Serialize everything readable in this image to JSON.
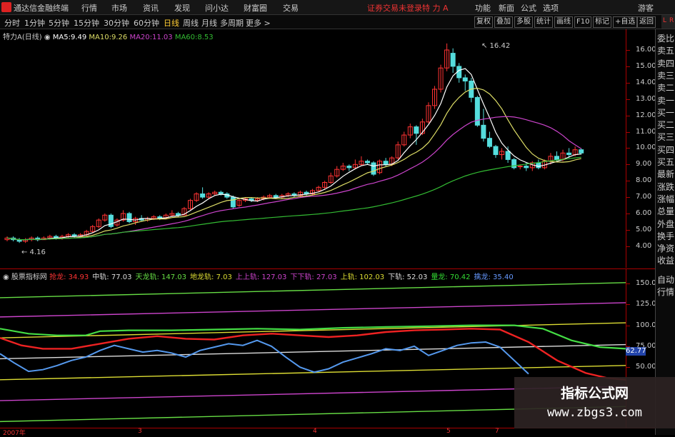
{
  "app": {
    "title": "通达信金融终端"
  },
  "menu": {
    "items": [
      "行情",
      "市场",
      "资讯",
      "发现",
      "问小达",
      "财富圈",
      "交易"
    ]
  },
  "status": {
    "login": "证券交易未登录",
    "stock": "特 力 A"
  },
  "right_menu": {
    "items": [
      "功能",
      "新面",
      "公式",
      "选项"
    ],
    "guest": "游客"
  },
  "periods": [
    "分时",
    "1分钟",
    "5分钟",
    "15分钟",
    "30分钟",
    "60分钟",
    "日线",
    "周线",
    "月线",
    "多周期",
    "更多 >"
  ],
  "active_period": "日线",
  "tools": [
    "复权",
    "叠加",
    "多股",
    "统计",
    "画线",
    "F10",
    "标记",
    "+自选",
    "返回"
  ],
  "main_legend": {
    "stock": "特力A",
    "period": "(日线)",
    "ma5_label": "MA5:",
    "ma5": "9.49",
    "ma10_label": "MA10:",
    "ma10": "9.26",
    "ma20_label": "MA20:",
    "ma20": "11.03",
    "ma60_label": "MA60:",
    "ma60": "8.53"
  },
  "price_axis": {
    "ticks": [
      "16.00",
      "15.00",
      "14.00",
      "13.00",
      "12.00",
      "11.00",
      "10.00",
      "9.00",
      "8.00",
      "7.00",
      "6.00",
      "5.00",
      "4.00"
    ]
  },
  "annotations": {
    "high": "16.42",
    "low": "4.16"
  },
  "ind_legend": {
    "name": "股票指标网",
    "items": [
      {
        "label": "抢龙:",
        "value": "34.93",
        "color": "#ff3333"
      },
      {
        "label": "中轨:",
        "value": "77.03",
        "color": "#dddddd"
      },
      {
        "label": "天龙轨:",
        "value": "147.03",
        "color": "#66dd44"
      },
      {
        "label": "地龙轨:",
        "value": "7.03",
        "color": "#dddd33"
      },
      {
        "label": "上上轨:",
        "value": "127.03",
        "color": "#cc44cc"
      },
      {
        "label": "下下轨:",
        "value": "27.03",
        "color": "#cc44cc"
      },
      {
        "label": "上轨:",
        "value": "102.03",
        "color": "#dddd33"
      },
      {
        "label": "下轨:",
        "value": "52.03",
        "color": "#dddddd"
      },
      {
        "label": "量龙:",
        "value": "70.42",
        "color": "#33dd33"
      },
      {
        "label": "擒龙:",
        "value": "35.40",
        "color": "#6699ff"
      }
    ]
  },
  "ind_axis": {
    "ticks": [
      "150.00",
      "125.00",
      "100.00",
      "75.00",
      "50.00"
    ],
    "last_value": "62.77"
  },
  "side_panel": {
    "items": [
      "委比",
      "卖五",
      "卖四",
      "卖三",
      "卖二",
      "卖一",
      "买一",
      "买二",
      "买三",
      "买四",
      "买五",
      "最新",
      "涨跌",
      "涨幅",
      "总量",
      "外盘",
      "换手",
      "净资",
      "收益",
      "自动",
      "行情"
    ]
  },
  "date_axis": {
    "ticks": [
      "2007年",
      "3",
      "4",
      "5",
      "7"
    ]
  },
  "watermark": {
    "title": "指标公式网",
    "url": "www.zbgs3.com"
  },
  "colors": {
    "up": "#ff3333",
    "down": "#55dddd",
    "ma5": "#ffffff",
    "ma10": "#dddd66",
    "ma20": "#cc44cc",
    "ma60": "#33bb33"
  }
}
